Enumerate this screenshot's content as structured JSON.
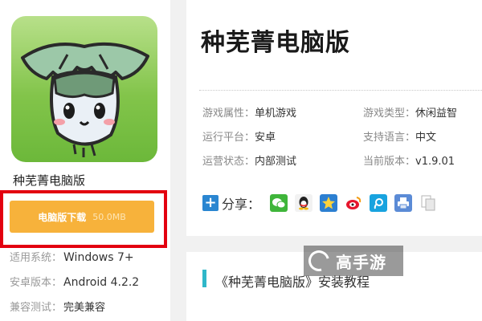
{
  "app": {
    "name": "种芜菁电脑版",
    "title": "种芜菁电脑版"
  },
  "download": {
    "label": "电脑版下载",
    "size": "50.0MB",
    "highlight_color": "#e3000f",
    "button_color": "#f7b23b"
  },
  "sidebar_info": [
    {
      "label": "适用系统：",
      "value": "Windows 7+"
    },
    {
      "label": "安卓版本：",
      "value": "Android 4.2.2"
    },
    {
      "label": "兼容测试：",
      "value": "完美兼容"
    }
  ],
  "attributes": [
    {
      "label": "游戏属性：",
      "value": "单机游戏"
    },
    {
      "label": "游戏类型：",
      "value": "休闲益智"
    },
    {
      "label": "运行平台：",
      "value": "安卓"
    },
    {
      "label": "支持语言：",
      "value": "中文"
    },
    {
      "label": "运营状态：",
      "value": "内部测试"
    },
    {
      "label": "当前版本：",
      "value": "v1.9.01"
    }
  ],
  "share": {
    "label": "分享：",
    "icons": [
      "wechat-icon",
      "qq-icon",
      "qzone-icon",
      "weibo-icon",
      "tencent-weibo-icon",
      "print-icon",
      "copy-icon"
    ]
  },
  "tutorial": {
    "title": "《种芜菁电脑版》安装教程",
    "accent_color": "#2fb7c9"
  },
  "watermark": {
    "text": "高手游"
  }
}
